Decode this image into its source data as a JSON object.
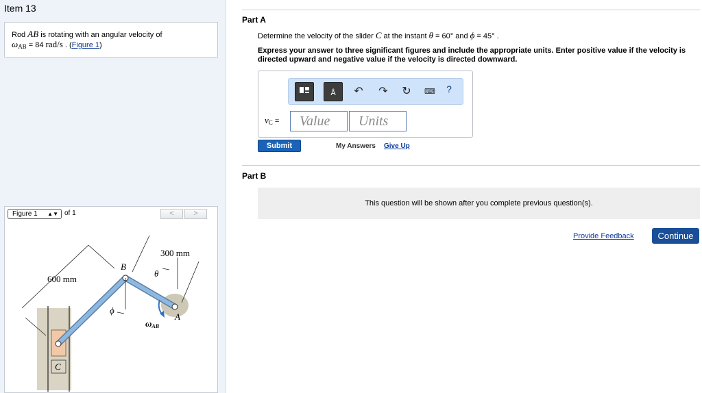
{
  "item": {
    "title": "Item 13"
  },
  "problem": {
    "text_before": "Rod ",
    "rod_name": "AB",
    "text_after": " is rotating with an angular velocity of",
    "omega_symbol": "ω",
    "omega_sub": "AB",
    "equals": " = 84 ",
    "unit": "rad/s",
    "period": " . (",
    "figure_link": "Figure 1",
    "close": ")"
  },
  "figure": {
    "select_label": "Figure 1",
    "of_label": "of 1",
    "prev_label": "<",
    "next_label": ">",
    "labels": {
      "dim_600": "600 mm",
      "dim_300": "300 mm",
      "point_b": "B",
      "point_a": "A",
      "point_c": "C",
      "theta": "θ",
      "phi": "ϕ",
      "omega": "ω",
      "omega_sub": "AB"
    }
  },
  "part_a": {
    "title": "Part A",
    "question_prefix": "Determine the velocity of the slider ",
    "slider": "C",
    "question_mid": " at the instant ",
    "theta": "θ",
    "theta_val": " = 60° ",
    "and": " and ",
    "phi": "ϕ",
    "phi_val": " = 45° .",
    "instructions": "Express your answer to three significant figures and include the appropriate units. Enter positive value if the velocity is directed upward and negative value if the velocity is directed downward.",
    "answer_label_v": "v",
    "answer_label_sub": "C",
    "answer_label_eq": " =",
    "value_placeholder": "Value",
    "units_placeholder": "Units",
    "toolbar": {
      "undo_icon": "undo-icon",
      "redo_icon": "redo-icon",
      "reset_icon": "reset-icon",
      "keyboard_icon": "keyboard-icon",
      "help_label": "?"
    },
    "submit_label": "Submit",
    "my_answers_label": "My Answers",
    "give_up_label": "Give Up"
  },
  "part_b": {
    "title": "Part B",
    "locked_message": "This question will be shown after you complete previous question(s)."
  },
  "footer": {
    "feedback_label": "Provide Feedback",
    "continue_label": "Continue"
  },
  "colors": {
    "rod": "#8fb8e0",
    "button_blue": "#1a63b8",
    "link": "#0d3b9c",
    "panel_bg": "#eef3fa"
  }
}
